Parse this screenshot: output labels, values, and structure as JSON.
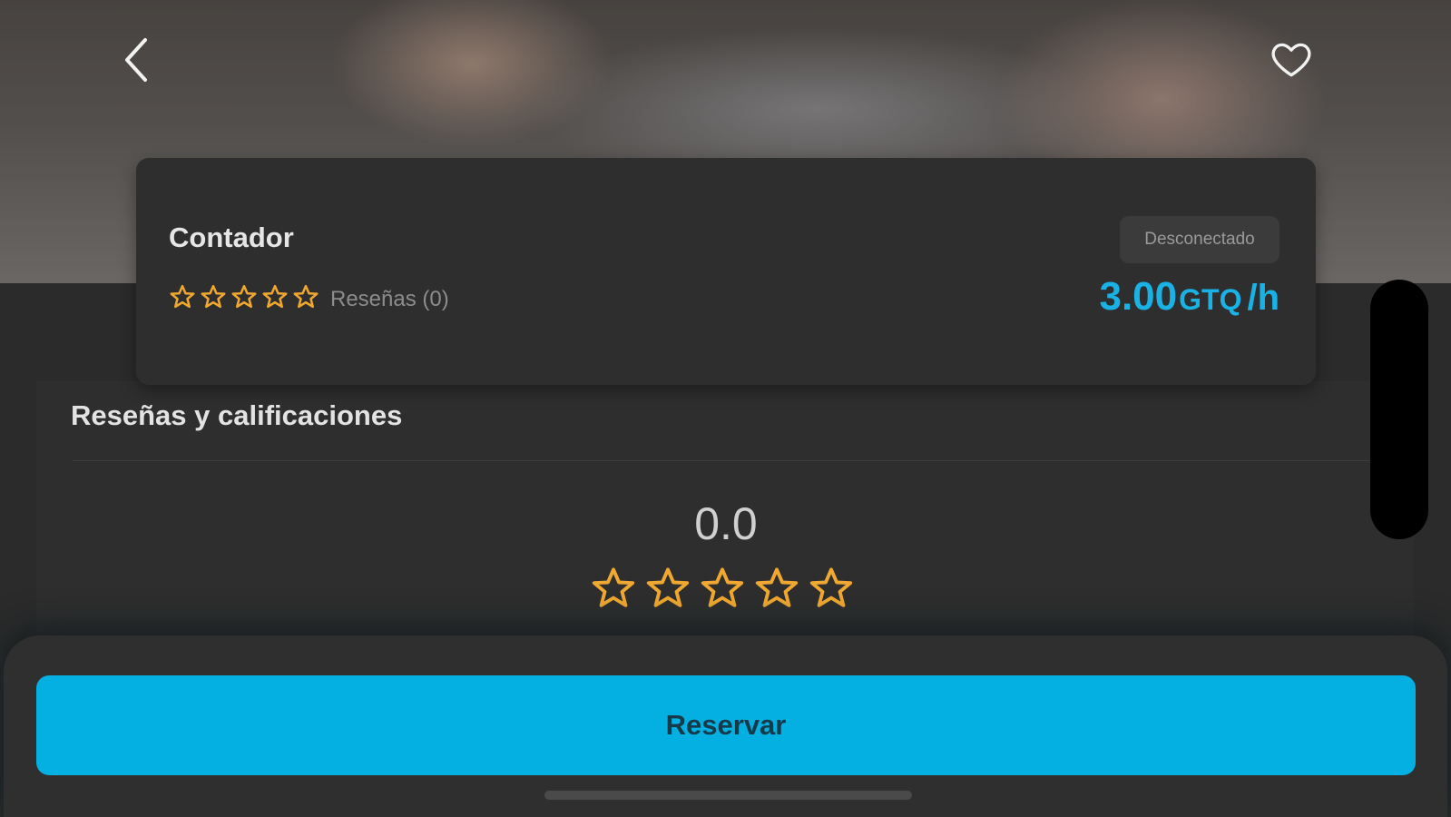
{
  "header": {
    "back_icon": "chevron-left-icon",
    "favorite_icon": "heart-outline-icon"
  },
  "service": {
    "title": "Contador",
    "rating_stars": 0,
    "reviews_label": "Reseñas (0)",
    "status": "Desconectado",
    "price_amount": "3.00",
    "price_currency": "GTQ",
    "price_unit": "/h"
  },
  "reviews": {
    "heading": "Reseñas y calificaciones",
    "average": "0.0",
    "stars": 0
  },
  "actions": {
    "book_label": "Reservar"
  },
  "colors": {
    "accent": "#1ab2e4",
    "button": "#04b0e2",
    "star": "#f0a830",
    "background": "#2b2b2b",
    "card": "#2e2e2e"
  }
}
